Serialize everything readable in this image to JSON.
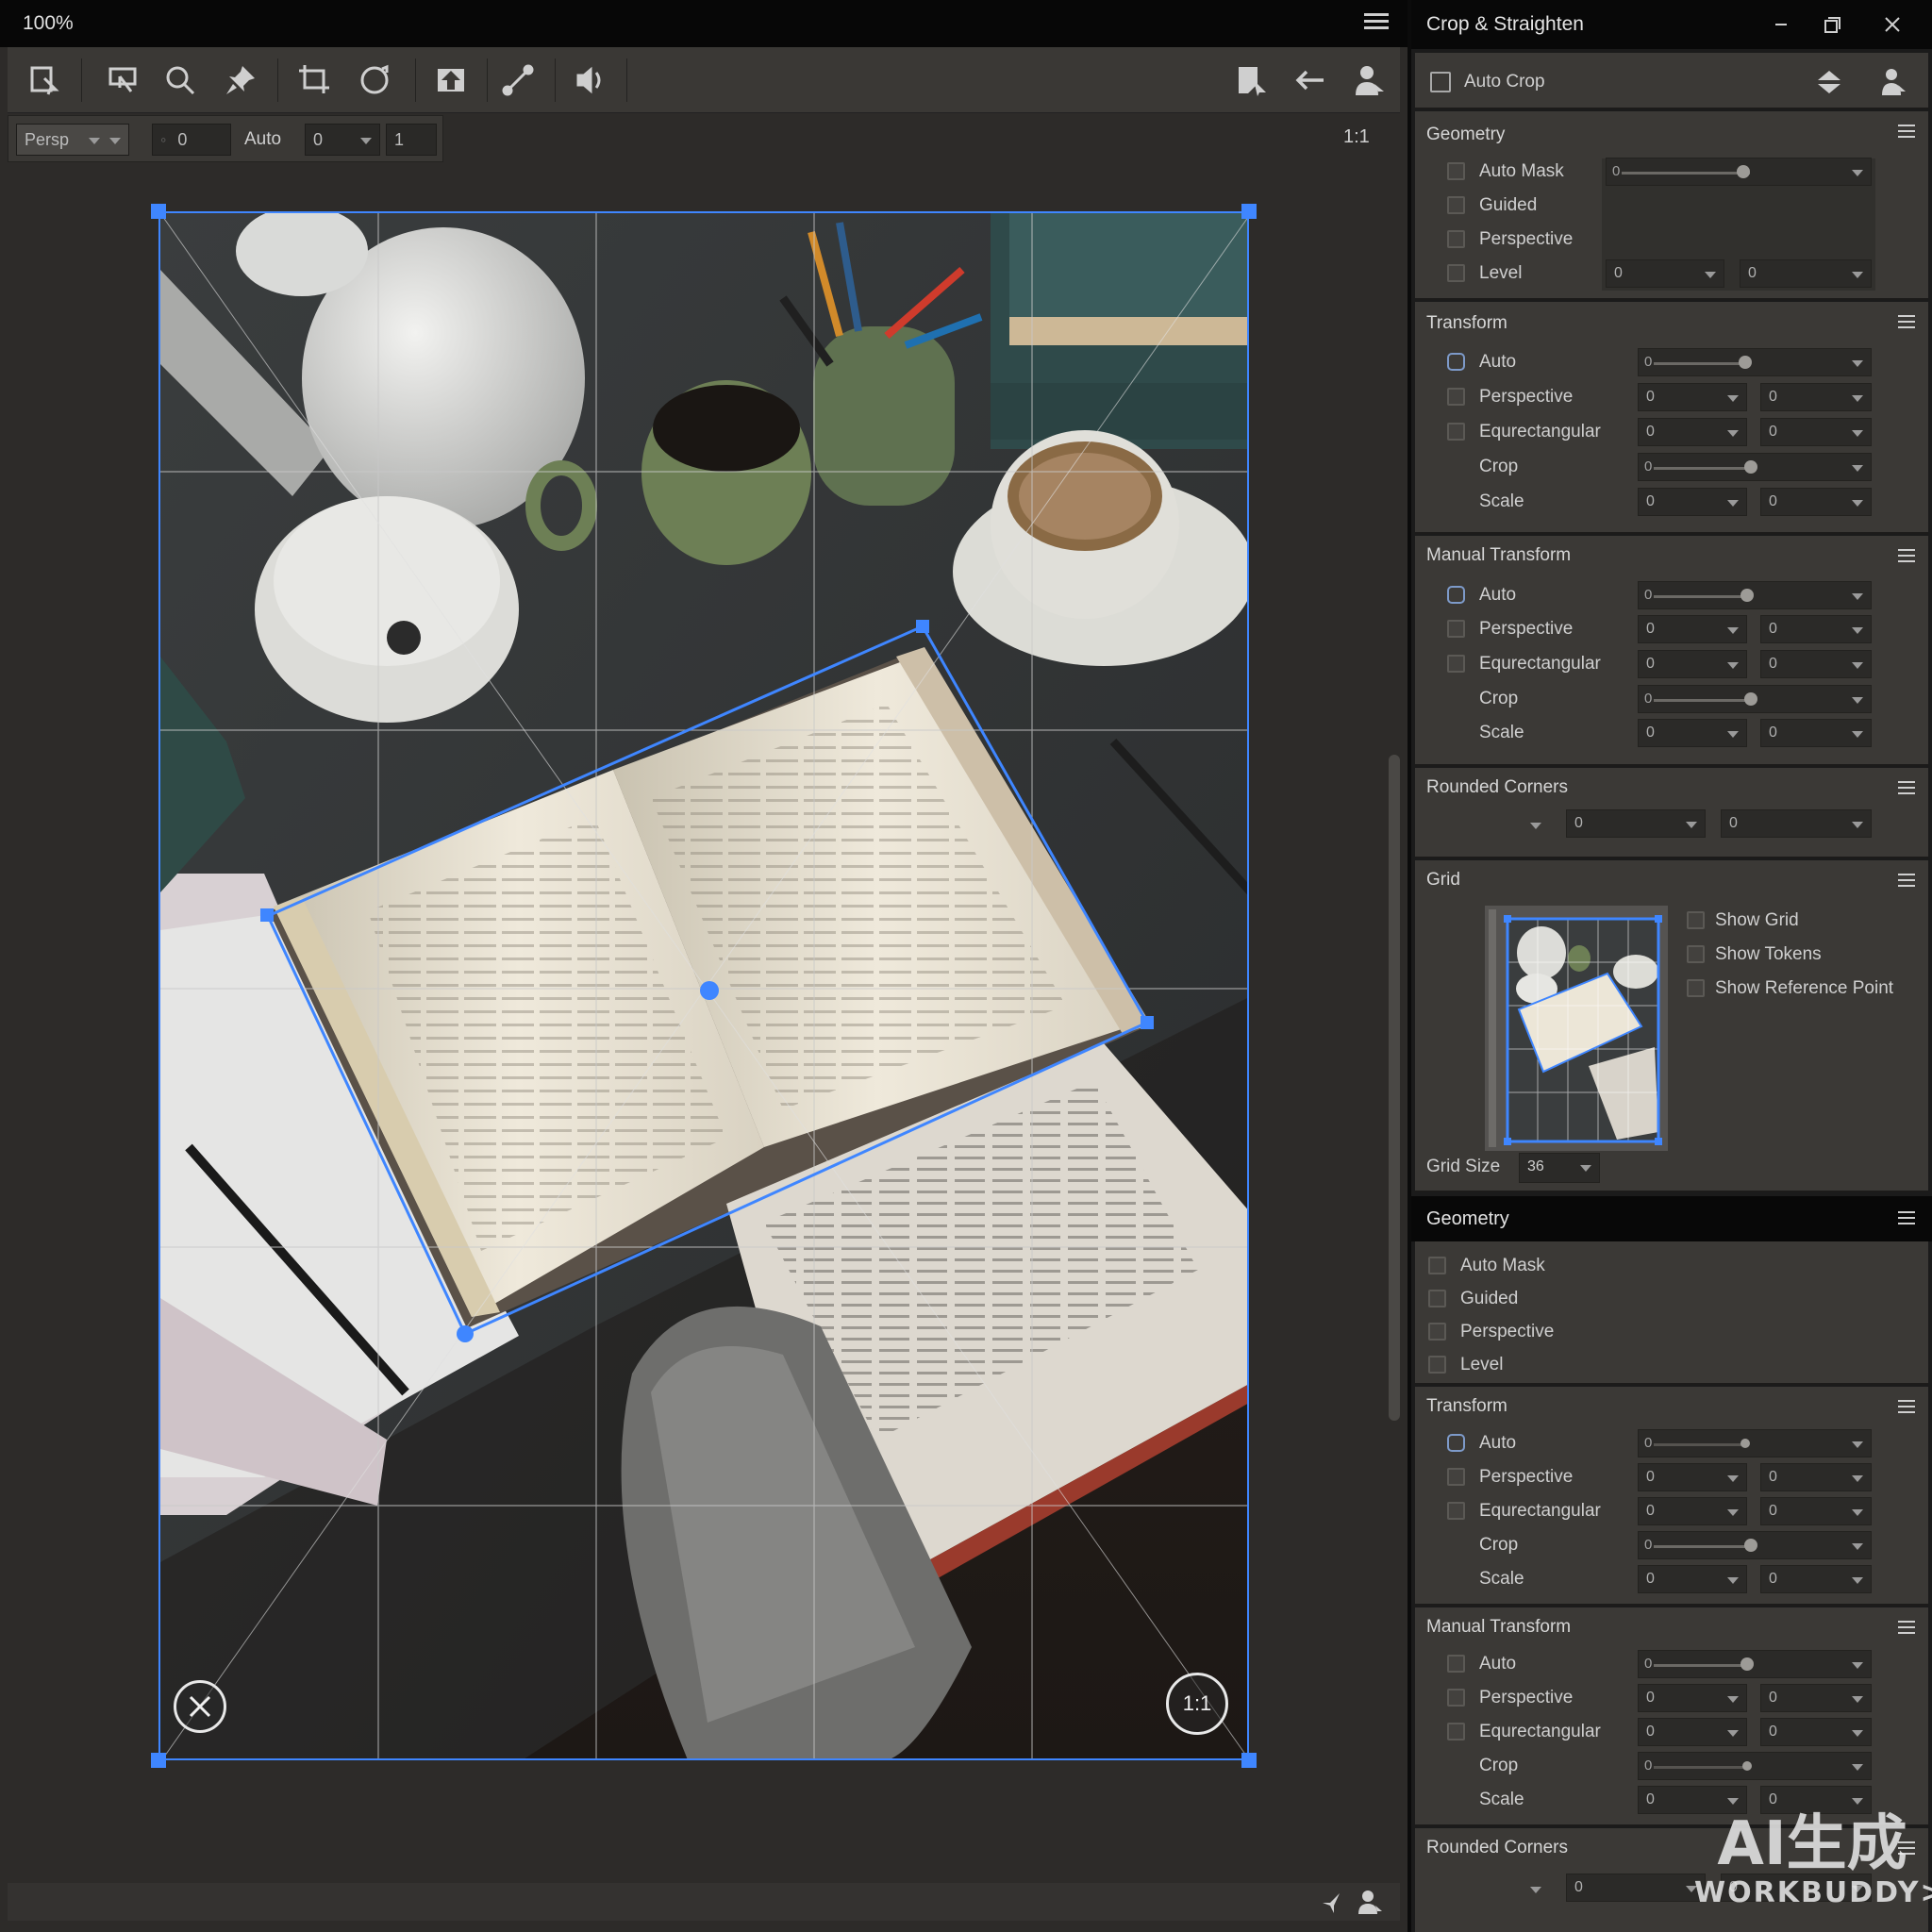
{
  "editor": {
    "zoom": "100%",
    "options": {
      "mode": "Persp",
      "value_a": "0",
      "auto_label": "Auto",
      "value_b": "0",
      "value_c": "1"
    },
    "ratio_label": "1:1",
    "ratio_button": "1:1"
  },
  "panel": {
    "title": "Crop & Straighten",
    "auto_crop": "Auto Crop",
    "geometry": {
      "title": "Geometry",
      "auto_mask": "Auto Mask",
      "guided": "Guided",
      "perspective": "Perspective",
      "level": "Level",
      "slider_value": "0",
      "level_a": "0",
      "level_b": "0"
    },
    "transform": {
      "title": "Transform",
      "auto": "Auto",
      "perspective": "Perspective",
      "equirect": "Equrectangular",
      "crop": "Crop",
      "scale": "Scale",
      "auto_value": "0",
      "persp_a": "0",
      "persp_b": "0",
      "equi_a": "0",
      "equi_b": "0",
      "crop_value": "0",
      "scale_a": "0",
      "scale_b": "0"
    },
    "manual_transform": {
      "title": "Manual Transform",
      "auto": "Auto",
      "perspective": "Perspective",
      "equirect": "Equrectangular",
      "crop": "Crop",
      "scale": "Scale",
      "auto_value": "0",
      "persp_a": "0",
      "persp_b": "0",
      "equi_a": "0",
      "equi_b": "0",
      "crop_value": "0",
      "scale_a": "0",
      "scale_b": "0"
    },
    "rounded_corners": {
      "title": "Rounded Corners",
      "value_a": "0",
      "value_b": "0"
    },
    "grid": {
      "title": "Grid",
      "show_grid": "Show Grid",
      "show_tokens": "Show Tokens",
      "show_reference_point": "Show Reference Point",
      "grid_size_label": "Grid Size",
      "grid_size": "36"
    },
    "geometry2": {
      "title": "Geometry",
      "auto_mask": "Auto Mask",
      "guided": "Guided",
      "perspective": "Perspective",
      "level": "Level"
    },
    "transform2": {
      "title": "Transform",
      "auto": "Auto",
      "perspective": "Perspective",
      "equirect": "Equrectangular",
      "crop": "Crop",
      "scale": "Scale",
      "auto_value": "0",
      "persp_a": "0",
      "persp_b": "0",
      "equi_a": "0",
      "equi_b": "0",
      "crop_value": "0",
      "scale_a": "0",
      "scale_b": "0"
    },
    "manual_transform2": {
      "title": "Manual Transform",
      "auto": "Auto",
      "perspective": "Perspective",
      "equirect": "Equrectangular",
      "crop": "Crop",
      "scale": "Scale",
      "auto_value": "0",
      "persp_a": "0",
      "persp_b": "0",
      "equi_a": "0",
      "equi_b": "0",
      "crop_value": "0",
      "scale_a": "0",
      "scale_b": "0"
    },
    "rounded_corners2": {
      "title": "Rounded Corners",
      "value_a": "0",
      "value_b": "0"
    }
  },
  "watermark": "AI生成 WORKBUDDY",
  "colors": {
    "accent": "#3f86ff",
    "panel_bg": "#3b3936",
    "editor_bg": "#2d2b29"
  },
  "icons": [
    "select-tool-icon",
    "transform-tool-icon",
    "zoom-tool-icon",
    "pin-tool-icon",
    "crop-tool-icon",
    "rotate-tool-icon",
    "import-tool-icon",
    "line-tool-icon",
    "audio-tool-icon",
    "export-icon",
    "back-arrow-icon",
    "user-icon",
    "close-icon"
  ]
}
